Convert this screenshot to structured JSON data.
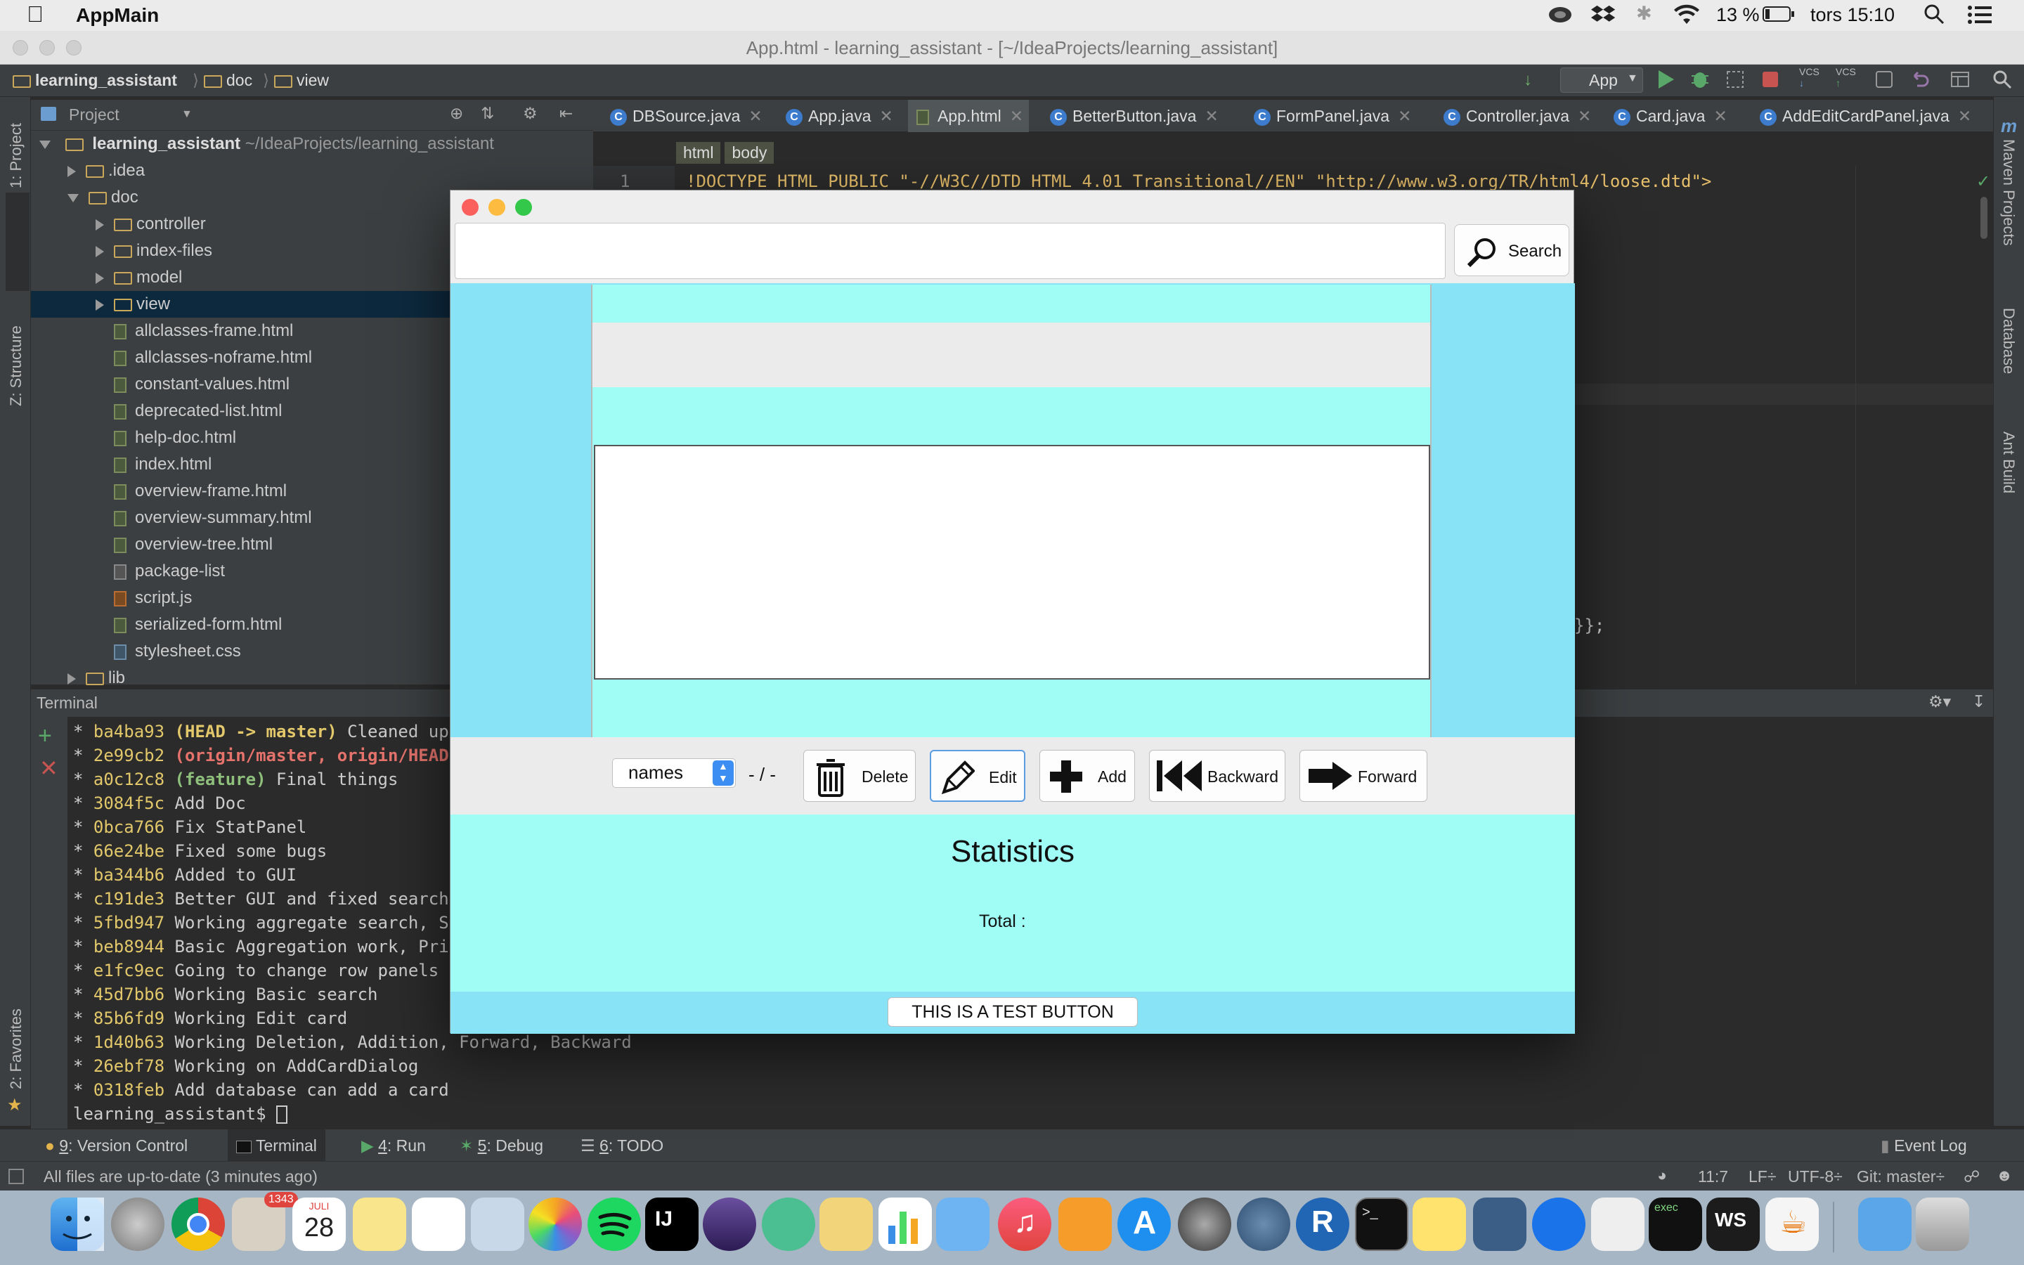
{
  "menubar": {
    "app_name": "AppMain",
    "battery": "13 %",
    "clock": "tors 15:10"
  },
  "window": {
    "title": "App.html - learning_assistant - [~/IdeaProjects/learning_assistant]"
  },
  "breadcrumb": [
    "learning_assistant",
    "doc",
    "view"
  ],
  "toolbar": {
    "run_config": "App"
  },
  "project_panel": {
    "title": "Project",
    "root_name": "learning_assistant",
    "root_path": "~/IdeaProjects/learning_assistant",
    "items": [
      {
        "label": ".idea",
        "kind": "folder",
        "depth": 1,
        "expanded": false
      },
      {
        "label": "doc",
        "kind": "folder",
        "depth": 1,
        "expanded": true
      },
      {
        "label": "controller",
        "kind": "folder",
        "depth": 2,
        "expanded": false
      },
      {
        "label": "index-files",
        "kind": "folder",
        "depth": 2,
        "expanded": false
      },
      {
        "label": "model",
        "kind": "folder",
        "depth": 2,
        "expanded": false
      },
      {
        "label": "view",
        "kind": "folder",
        "depth": 2,
        "expanded": false,
        "selected": true
      },
      {
        "label": "allclasses-frame.html",
        "kind": "html",
        "depth": 2
      },
      {
        "label": "allclasses-noframe.html",
        "kind": "html",
        "depth": 2
      },
      {
        "label": "constant-values.html",
        "kind": "html",
        "depth": 2
      },
      {
        "label": "deprecated-list.html",
        "kind": "html",
        "depth": 2
      },
      {
        "label": "help-doc.html",
        "kind": "html",
        "depth": 2
      },
      {
        "label": "index.html",
        "kind": "html",
        "depth": 2
      },
      {
        "label": "overview-frame.html",
        "kind": "html",
        "depth": 2
      },
      {
        "label": "overview-summary.html",
        "kind": "html",
        "depth": 2
      },
      {
        "label": "overview-tree.html",
        "kind": "html",
        "depth": 2
      },
      {
        "label": "package-list",
        "kind": "plain",
        "depth": 2
      },
      {
        "label": "script.js",
        "kind": "js",
        "depth": 2
      },
      {
        "label": "serialized-form.html",
        "kind": "html",
        "depth": 2
      },
      {
        "label": "stylesheet.css",
        "kind": "css",
        "depth": 2
      },
      {
        "label": "lib",
        "kind": "folder",
        "depth": 1,
        "expanded": false
      }
    ]
  },
  "left_strip": {
    "project": "1: Project",
    "structure": "Z: Structure",
    "favorites": "2: Favorites"
  },
  "right_strip": {
    "maven": "Maven Projects",
    "database": "Database",
    "ant": "Ant Build"
  },
  "editor": {
    "tabs": [
      {
        "label": "DBSource.java",
        "icon": "class-icon"
      },
      {
        "label": "App.java",
        "icon": "class-icon"
      },
      {
        "label": "App.html",
        "icon": "html-file-icon",
        "active": true
      },
      {
        "label": "BetterButton.java",
        "icon": "class-icon"
      },
      {
        "label": "FormPanel.java",
        "icon": "class-icon"
      },
      {
        "label": "Controller.java",
        "icon": "class-icon"
      },
      {
        "label": "Card.java",
        "icon": "class-icon"
      },
      {
        "label": "AddEditCardPanel.java",
        "icon": "class-icon"
      }
    ],
    "tag_path": [
      "html",
      "body"
    ],
    "line_number": "1",
    "code_line": "!DOCTYPE HTML PUBLIC \"-//W3C//DTD HTML 4.01 Transitional//EN\" \"http://www.w3.org/TR/html4/loose.dtd\">",
    "code_fragment": "}};"
  },
  "terminal": {
    "title": "Terminal",
    "lines": [
      {
        "hash": "ba4ba93",
        "refs": "(HEAD -> master)",
        "ref_style": "head",
        "msg": "Cleaned up"
      },
      {
        "hash": "2e99cb2",
        "refs": "(origin/master, origin/HEAD)",
        "ref_style": "orig",
        "msg": ""
      },
      {
        "hash": "a0c12c8",
        "refs": "(feature)",
        "ref_style": "feat",
        "msg": "Final things"
      },
      {
        "hash": "3084f5c",
        "refs": "",
        "ref_style": "",
        "msg": "Add Doc"
      },
      {
        "hash": "0bca766",
        "refs": "",
        "ref_style": "",
        "msg": "Fix StatPanel"
      },
      {
        "hash": "66e24be",
        "refs": "",
        "ref_style": "",
        "msg": "Fixed some bugs"
      },
      {
        "hash": "ba344b6",
        "refs": "",
        "ref_style": "",
        "msg": "Added to GUI"
      },
      {
        "hash": "c191de3",
        "refs": "",
        "ref_style": "",
        "msg": "Better GUI and fixed search b"
      },
      {
        "hash": "5fbd947",
        "refs": "",
        "ref_style": "",
        "msg": "Working aggregate search, Sor"
      },
      {
        "hash": "beb8944",
        "refs": "",
        "ref_style": "",
        "msg": "Basic Aggregation work, Prior"
      },
      {
        "hash": "e1fc9ec",
        "refs": "",
        "ref_style": "",
        "msg": "Going to change row panels"
      },
      {
        "hash": "45d7bb6",
        "refs": "",
        "ref_style": "",
        "msg": "Working Basic search"
      },
      {
        "hash": "85b6fd9",
        "refs": "",
        "ref_style": "",
        "msg": "Working Edit card"
      },
      {
        "hash": "1d40b63",
        "refs": "",
        "ref_style": "",
        "msg": "Working Deletion, Addition, Forward, Backward"
      },
      {
        "hash": "26ebf78",
        "refs": "",
        "ref_style": "",
        "msg": "Working on AddCardDialog"
      },
      {
        "hash": "0318feb",
        "refs": "",
        "ref_style": "",
        "msg": "Add database can add a card"
      }
    ],
    "prompt": "learning_assistant$ "
  },
  "tool_windows": [
    {
      "key": "9",
      "label": ": Version Control"
    },
    {
      "key": "",
      "label": "Terminal",
      "active": true
    },
    {
      "key": "4",
      "label": ": Run"
    },
    {
      "key": "5",
      "label": ": Debug"
    },
    {
      "key": "6",
      "label": ": TODO"
    }
  ],
  "event_log": "Event Log",
  "status": {
    "message": "All files are up-to-date (3 minutes ago)",
    "position": "11:7",
    "line_sep": "LF÷",
    "encoding": "UTF-8÷",
    "git": "Git: master÷"
  },
  "dialog": {
    "search_placeholder": "",
    "search_label": "Search",
    "combo_value": "names",
    "counter": "- / -",
    "buttons": {
      "delete": "Delete",
      "edit": "Edit",
      "add": "Add",
      "backward": "Backward",
      "forward": "Forward"
    },
    "stats_title": "Statistics",
    "total_label": "Total :",
    "test_button": "THIS IS A TEST BUTTON",
    "colors": {
      "outer": "#89e3f7",
      "inner": "#9ffdf6",
      "panel": "#ebebeb"
    }
  },
  "dock": {
    "calendar_month": "JULI",
    "calendar_day": "28",
    "mail_badge": "1343",
    "exec_label": "exec",
    "ws_label": "WS",
    "ij_label": "IJ",
    "r_label": "R"
  }
}
